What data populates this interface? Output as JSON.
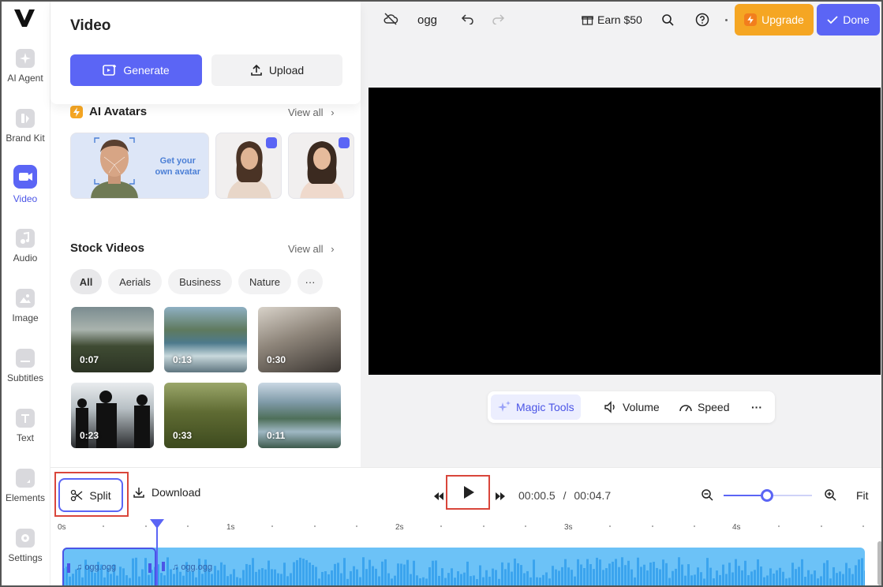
{
  "app": {
    "logo": "V",
    "project_name": "ogg"
  },
  "rail": {
    "items": [
      {
        "label": "AI Agent",
        "icon": "sparkle-icon"
      },
      {
        "label": "Brand Kit",
        "icon": "brand-kit-icon"
      },
      {
        "label": "Video",
        "icon": "video-camera-icon",
        "active": true
      },
      {
        "label": "Audio",
        "icon": "music-note-icon"
      },
      {
        "label": "Image",
        "icon": "image-icon"
      },
      {
        "label": "Subtitles",
        "icon": "subtitles-icon"
      },
      {
        "label": "Text",
        "icon": "text-t-icon"
      },
      {
        "label": "Elements",
        "icon": "elements-icon"
      },
      {
        "label": "Settings",
        "icon": "settings-icon"
      }
    ]
  },
  "panel": {
    "title": "Video",
    "generate_label": "Generate",
    "upload_label": "Upload",
    "avatars": {
      "title": "AI Avatars",
      "view_all": "View all",
      "own_avatar_line1": "Get your",
      "own_avatar_line2": "own avatar"
    },
    "stock": {
      "title": "Stock Videos",
      "view_all": "View all",
      "chips": [
        "All",
        "Aerials",
        "Business",
        "Nature"
      ],
      "more": "···",
      "thumbs": [
        {
          "duration": "0:07",
          "scene": "forest-aerial"
        },
        {
          "duration": "0:13",
          "scene": "rocky-coast"
        },
        {
          "duration": "0:30",
          "scene": "business-meeting"
        },
        {
          "duration": "0:23",
          "scene": "silhouettes-office"
        },
        {
          "duration": "0:33",
          "scene": "grass-field"
        },
        {
          "duration": "0:11",
          "scene": "mountain-lake"
        }
      ]
    }
  },
  "topbar": {
    "earn_label": "Earn $50",
    "upgrade_label": "Upgrade",
    "done_label": "Done"
  },
  "tools": {
    "magic": "Magic Tools",
    "volume": "Volume",
    "speed": "Speed",
    "more": "···"
  },
  "timeline": {
    "split_label": "Split",
    "download_label": "Download",
    "current_time": "00:00.5",
    "separator": "/",
    "total_time": "00:04.7",
    "fit_label": "Fit",
    "ruler": [
      "0s",
      "1s",
      "2s",
      "3s",
      "4s"
    ],
    "clip_name_1": "ogg.ogg",
    "clip_name_2": "ogg.ogg",
    "zoom_level": 0.5
  },
  "colors": {
    "accent": "#5b65f5",
    "upgrade": "#f5a623",
    "track": "#6cc2f7",
    "highlight": "#d9463b"
  }
}
